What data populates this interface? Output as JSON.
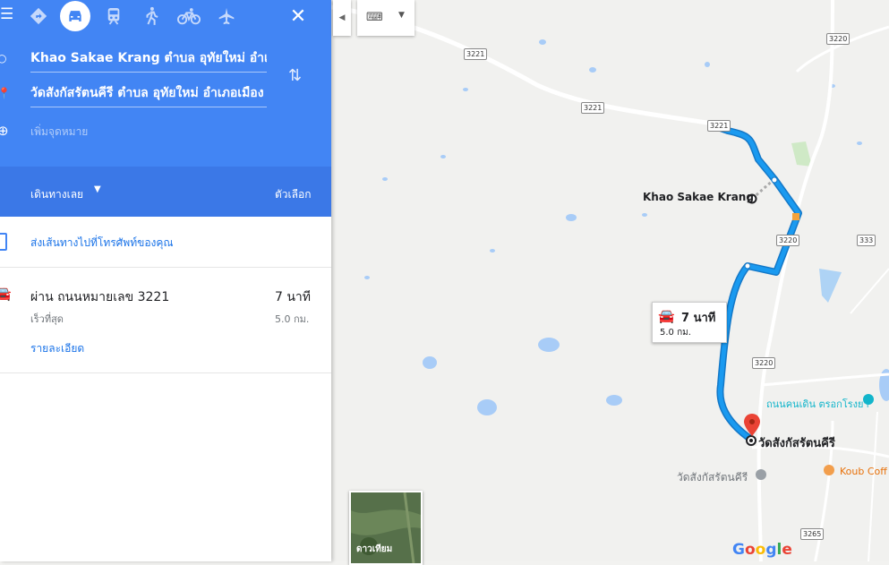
{
  "travel_modes": [
    {
      "name": "best-route",
      "glyph": "◆"
    },
    {
      "name": "driving",
      "glyph": "🚘",
      "active": true
    },
    {
      "name": "transit",
      "glyph": "🚆"
    },
    {
      "name": "walking",
      "glyph": "🚶"
    },
    {
      "name": "cycling",
      "glyph": "🚲"
    },
    {
      "name": "flight",
      "glyph": "✈"
    }
  ],
  "origin": "Khao Sakae Krang ตำบล อุทัยใหม่ อำเภอเมือง",
  "destination": "วัดสังกัสรัตนคีรี ตำบล อุทัยใหม่ อำเภอเมือง",
  "add_destination": "เพิ่มจุดหมาย",
  "start_now": "เดินทางเลย",
  "options": "ตัวเลือก",
  "send_to_phone": "ส่งเส้นทางไปที่โทรศัพท์ของคุณ",
  "route": {
    "via": "ผ่าน ถนนหมายเลข 3221",
    "time": "7 นาที",
    "fastest": "เร็วที่สุด",
    "distance": "5.0 กม.",
    "details": "รายละเอียด"
  },
  "map": {
    "origin_label": "Khao Sakae Krang",
    "destination_label": "วัดสังกัสรัตนคีรี",
    "temple_label": "วัดสังกัสรัตนคีรี",
    "poi_label": "ถนนคนเดิน ตรอกโรงยา",
    "cafe_label": "Koub Coff",
    "time_box": {
      "time": "7 นาที",
      "distance": "5.0 กม."
    },
    "shields": [
      "3221",
      "3221",
      "3221",
      "3220",
      "3220",
      "3220",
      "333",
      "3265"
    ],
    "satellite_label": "ดาวเทียม",
    "google": "Google",
    "route_color": "#1a9af0"
  }
}
